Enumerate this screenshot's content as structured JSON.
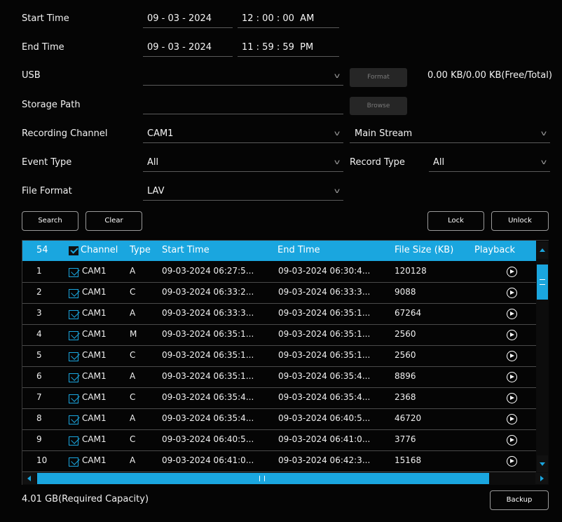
{
  "form": {
    "start_time": {
      "label": "Start Time",
      "date": "09 - 03 - 2024",
      "time": "12 : 00 : 00  AM"
    },
    "end_time": {
      "label": "End Time",
      "date": "09 - 03 - 2024",
      "time": "11 : 59 : 59  PM"
    },
    "usb": {
      "label": "USB",
      "value": "",
      "format_label": "Format",
      "capacity_text": "0.00 KB/0.00 KB(Free/Total)"
    },
    "storage_path": {
      "label": "Storage Path",
      "value": "",
      "browse_label": "Browse"
    },
    "recording_channel": {
      "label": "Recording Channel",
      "value": "CAM1",
      "stream": "Main Stream"
    },
    "event_type": {
      "label": "Event Type",
      "value": "All"
    },
    "record_type": {
      "label": "Record Type",
      "value": "All"
    },
    "file_format": {
      "label": "File Format",
      "value": "LAV"
    }
  },
  "buttons": {
    "search": "Search",
    "clear": "Clear",
    "lock": "Lock",
    "unlock": "Unlock",
    "backup": "Backup"
  },
  "table": {
    "total": "54",
    "headers": {
      "channel": "Channel",
      "type": "Type",
      "start_time": "Start Time",
      "end_time": "End Time",
      "file_size": "File Size (KB)",
      "playback": "Playback"
    },
    "rows": [
      {
        "no": "1",
        "channel": "CAM1",
        "type": "A",
        "start": "09-03-2024 06:27:5...",
        "end": "09-03-2024 06:30:4...",
        "size": "120128"
      },
      {
        "no": "2",
        "channel": "CAM1",
        "type": "C",
        "start": "09-03-2024 06:33:2...",
        "end": "09-03-2024 06:33:3...",
        "size": "9088"
      },
      {
        "no": "3",
        "channel": "CAM1",
        "type": "A",
        "start": "09-03-2024 06:33:3...",
        "end": "09-03-2024 06:35:1...",
        "size": "67264"
      },
      {
        "no": "4",
        "channel": "CAM1",
        "type": "M",
        "start": "09-03-2024 06:35:1...",
        "end": "09-03-2024 06:35:1...",
        "size": "2560"
      },
      {
        "no": "5",
        "channel": "CAM1",
        "type": "C",
        "start": "09-03-2024 06:35:1...",
        "end": "09-03-2024 06:35:1...",
        "size": "2560"
      },
      {
        "no": "6",
        "channel": "CAM1",
        "type": "A",
        "start": "09-03-2024 06:35:1...",
        "end": "09-03-2024 06:35:4...",
        "size": "8896"
      },
      {
        "no": "7",
        "channel": "CAM1",
        "type": "C",
        "start": "09-03-2024 06:35:4...",
        "end": "09-03-2024 06:35:4...",
        "size": "2368"
      },
      {
        "no": "8",
        "channel": "CAM1",
        "type": "A",
        "start": "09-03-2024 06:35:4...",
        "end": "09-03-2024 06:40:5...",
        "size": "46720"
      },
      {
        "no": "9",
        "channel": "CAM1",
        "type": "C",
        "start": "09-03-2024 06:40:5...",
        "end": "09-03-2024 06:41:0...",
        "size": "3776"
      },
      {
        "no": "10",
        "channel": "CAM1",
        "type": "A",
        "start": "09-03-2024 06:41:0...",
        "end": "09-03-2024 06:42:3...",
        "size": "15168"
      }
    ]
  },
  "footer": {
    "required_capacity": "4.01 GB(Required Capacity)"
  },
  "colors": {
    "accent": "#1aa6df",
    "background": "#050505"
  },
  "icons": {
    "dropdown": "chevron-down-icon",
    "playback": "play-circle-icon"
  }
}
